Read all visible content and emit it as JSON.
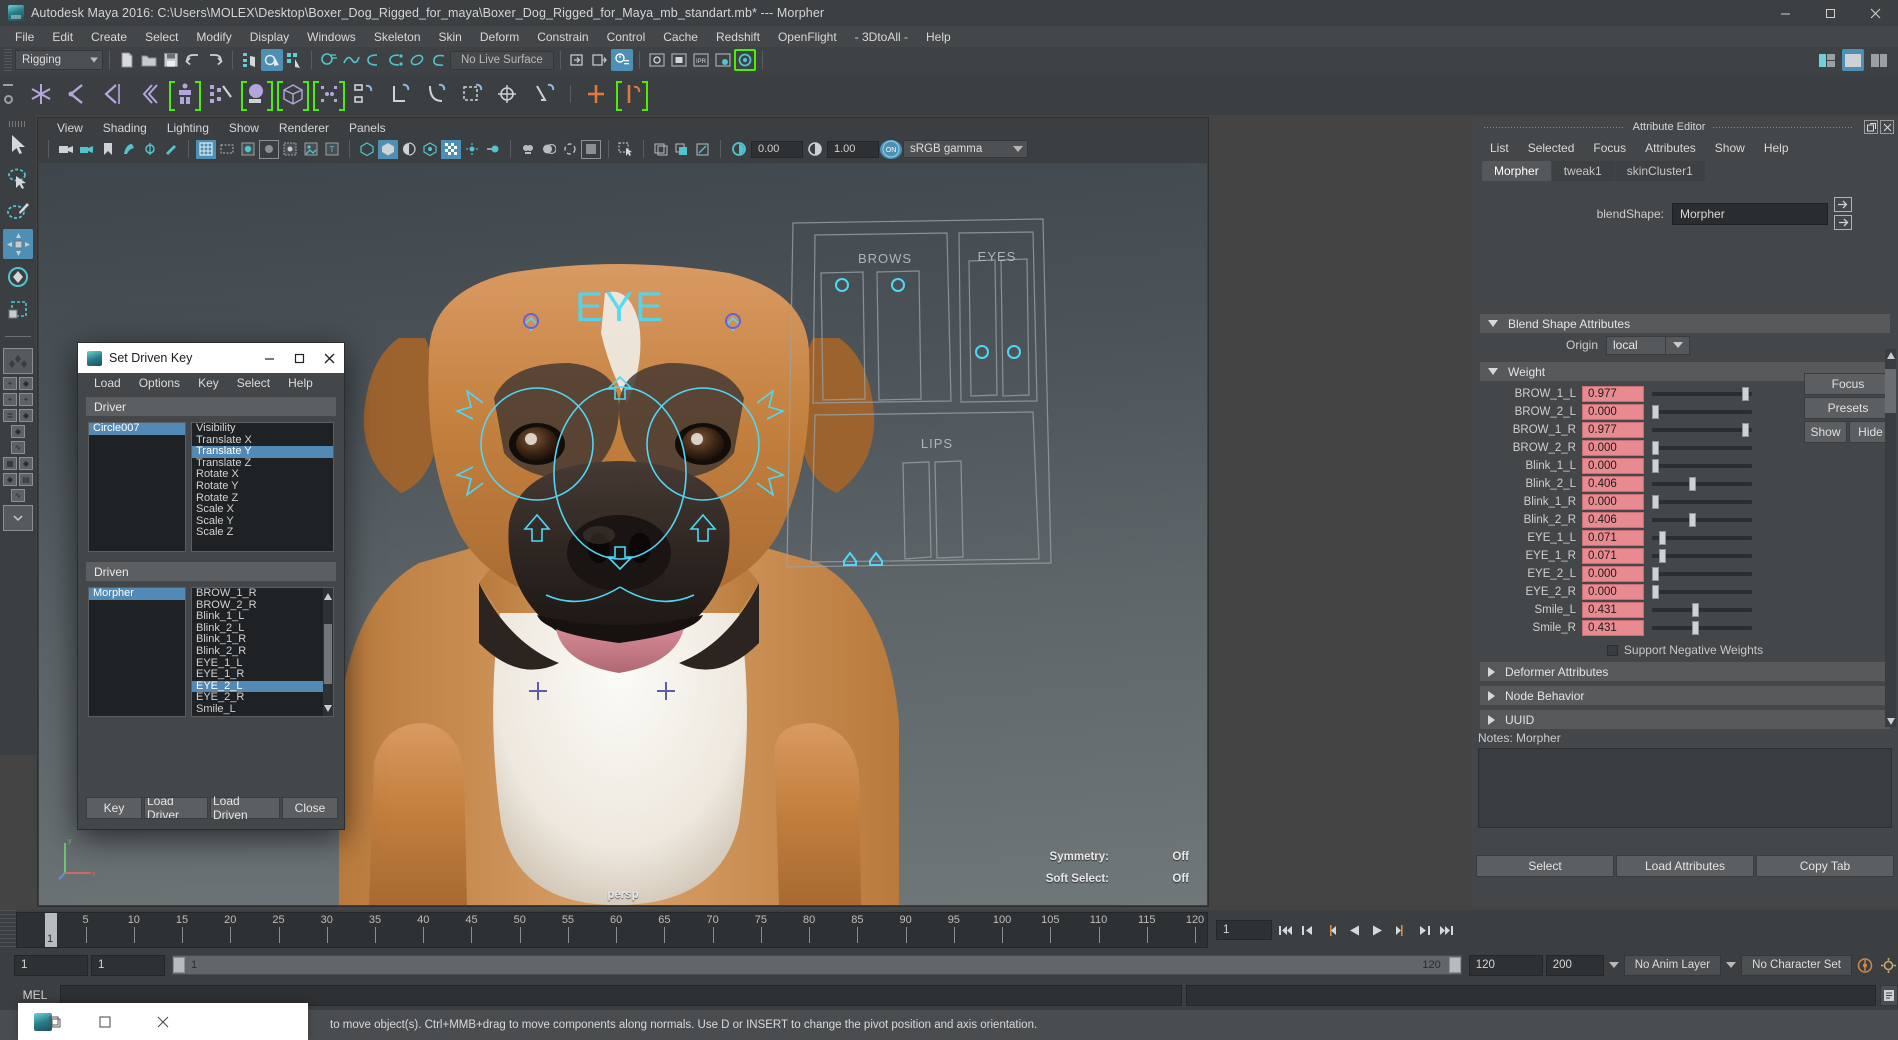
{
  "titlebar": {
    "title": "Autodesk Maya 2016: C:\\Users\\MOLEX\\Desktop\\Boxer_Dog_Rigged_for_maya\\Boxer_Dog_Rigged_for_Maya_mb_standart.mb*  ---  Morpher",
    "icon": "maya-icon",
    "minimize": "─",
    "maximize": "□",
    "close": "✕"
  },
  "menubar": {
    "items": [
      "File",
      "Edit",
      "Create",
      "Select",
      "Modify",
      "Display",
      "Windows",
      "Skeleton",
      "Skin",
      "Deform",
      "Constrain",
      "Control",
      "Cache",
      "Redshift",
      "OpenFlight",
      "- 3DtoAll -",
      "Help"
    ]
  },
  "statusbar": {
    "menuset": "Rigging",
    "no_live_surface": "No Live Surface"
  },
  "viewport": {
    "menu": [
      "View",
      "Shading",
      "Lighting",
      "Show",
      "Renderer",
      "Panels"
    ],
    "exposure": "0.00",
    "gamma": "1.00",
    "color_profile": "sRGB gamma",
    "camera_label": "persp",
    "hud": [
      {
        "label": "Symmetry:",
        "value": "Off"
      },
      {
        "label": "Soft Select:",
        "value": "Off"
      }
    ],
    "rig_panel_labels": [
      "BROWS",
      "EYES",
      "LIPS"
    ],
    "eye_ctrl_label": "EYE"
  },
  "set_driven_key": {
    "title": "Set Driven Key",
    "menu": [
      "Load",
      "Options",
      "Key",
      "Select",
      "Help"
    ],
    "driver": {
      "header": "Driver",
      "objects": [
        {
          "name": "Circle007",
          "selected": true
        }
      ],
      "attributes": [
        {
          "name": "Visibility",
          "selected": false
        },
        {
          "name": "Translate X",
          "selected": false
        },
        {
          "name": "Translate Y",
          "selected": true
        },
        {
          "name": "Translate Z",
          "selected": false
        },
        {
          "name": "Rotate X",
          "selected": false
        },
        {
          "name": "Rotate Y",
          "selected": false
        },
        {
          "name": "Rotate Z",
          "selected": false
        },
        {
          "name": "Scale X",
          "selected": false
        },
        {
          "name": "Scale Y",
          "selected": false
        },
        {
          "name": "Scale Z",
          "selected": false
        }
      ]
    },
    "driven": {
      "header": "Driven",
      "objects": [
        {
          "name": "Morpher",
          "selected": true
        }
      ],
      "attributes": [
        {
          "name": "BROW_1_R",
          "selected": false
        },
        {
          "name": "BROW_2_R",
          "selected": false
        },
        {
          "name": "Blink_1_L",
          "selected": false
        },
        {
          "name": "Blink_2_L",
          "selected": false
        },
        {
          "name": "Blink_1_R",
          "selected": false
        },
        {
          "name": "Blink_2_R",
          "selected": false
        },
        {
          "name": "EYE_1_L",
          "selected": false
        },
        {
          "name": "EYE_1_R",
          "selected": false
        },
        {
          "name": "EYE_2_L",
          "selected": true
        },
        {
          "name": "EYE_2_R",
          "selected": false
        },
        {
          "name": "Smile_L",
          "selected": false
        },
        {
          "name": "Smile_R",
          "selected": false
        }
      ]
    },
    "buttons": [
      "Key",
      "Load Driver",
      "Load Driven",
      "Close"
    ]
  },
  "attribute_editor": {
    "title": "Attribute Editor",
    "menu": [
      "List",
      "Selected",
      "Focus",
      "Attributes",
      "Show",
      "Help"
    ],
    "tabs": [
      {
        "label": "Morpher",
        "active": true
      },
      {
        "label": "tweak1",
        "active": false
      },
      {
        "label": "skinCluster1",
        "active": false
      }
    ],
    "blendshape_label": "blendShape:",
    "blendshape_value": "Morpher",
    "side_buttons": [
      "Focus",
      "Presets"
    ],
    "show_button": "Show",
    "hide_button": "Hide",
    "sections": {
      "blend_shape_attributes": "Blend Shape Attributes",
      "weight": "Weight",
      "deformer_attributes": "Deformer Attributes",
      "node_behavior": "Node Behavior",
      "uuid": "UUID"
    },
    "origin_label": "Origin",
    "origin_value": "local",
    "weights": [
      {
        "name": "BROW_1_L",
        "value": "0.977",
        "pos": 0.977
      },
      {
        "name": "BROW_2_L",
        "value": "0.000",
        "pos": 0.0
      },
      {
        "name": "BROW_1_R",
        "value": "0.977",
        "pos": 0.977
      },
      {
        "name": "BROW_2_R",
        "value": "0.000",
        "pos": 0.0
      },
      {
        "name": "Blink_1_L",
        "value": "0.000",
        "pos": 0.0
      },
      {
        "name": "Blink_2_L",
        "value": "0.406",
        "pos": 0.406
      },
      {
        "name": "Blink_1_R",
        "value": "0.000",
        "pos": 0.0
      },
      {
        "name": "Blink_2_R",
        "value": "0.406",
        "pos": 0.406
      },
      {
        "name": "EYE_1_L",
        "value": "0.071",
        "pos": 0.071
      },
      {
        "name": "EYE_1_R",
        "value": "0.071",
        "pos": 0.071
      },
      {
        "name": "EYE_2_L",
        "value": "0.000",
        "pos": 0.0
      },
      {
        "name": "EYE_2_R",
        "value": "0.000",
        "pos": 0.0
      },
      {
        "name": "Smile_L",
        "value": "0.431",
        "pos": 0.431
      },
      {
        "name": "Smile_R",
        "value": "0.431",
        "pos": 0.431
      }
    ],
    "support_negative_weights": "Support Negative Weights",
    "notes_label": "Notes: Morpher",
    "bottom_buttons": [
      "Select",
      "Load Attributes",
      "Copy Tab"
    ]
  },
  "timeline": {
    "ticks": [
      "1",
      "5",
      "10",
      "15",
      "20",
      "25",
      "30",
      "35",
      "40",
      "45",
      "50",
      "55",
      "60",
      "65",
      "70",
      "75",
      "80",
      "85",
      "90",
      "95",
      "100",
      "105",
      "110",
      "115",
      "120"
    ],
    "current_frame": "1",
    "current_frame_field": "1"
  },
  "range": {
    "start": "1",
    "end": "1",
    "slider_start": "1",
    "slider_end": "120",
    "anim_end": "120",
    "playback_end": "200",
    "anim_layer": "No Anim Layer",
    "character_set": "No Character Set"
  },
  "command": {
    "label": "MEL"
  },
  "help": {
    "text": "to move object(s). Ctrl+MMB+drag to move components along normals. Use D or INSERT to change the pivot position and axis orientation."
  },
  "taskbar": {
    "icons": [
      "maya-taskbar-icon",
      "copy-icon",
      "square-icon",
      "close-icon"
    ]
  },
  "colors": {
    "accent_blue": "#4e8fb5",
    "weight_field": "#e98a90",
    "panel_bg": "#444749",
    "green_highlight": "#4bf000",
    "rig_cyan": "#4fd7f5"
  }
}
